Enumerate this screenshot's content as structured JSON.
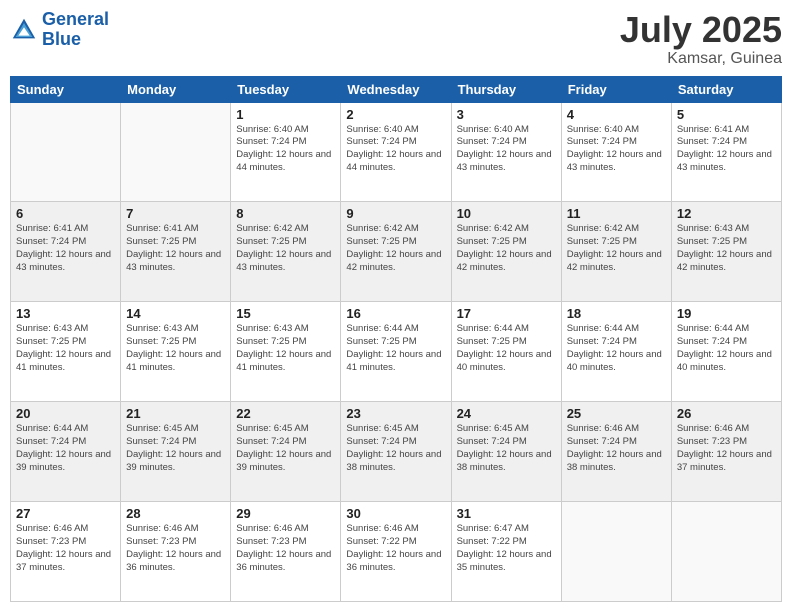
{
  "logo": {
    "line1": "General",
    "line2": "Blue"
  },
  "header": {
    "month": "July 2025",
    "location": "Kamsar, Guinea"
  },
  "weekdays": [
    "Sunday",
    "Monday",
    "Tuesday",
    "Wednesday",
    "Thursday",
    "Friday",
    "Saturday"
  ],
  "weeks": [
    [
      {
        "day": "",
        "sunrise": "",
        "sunset": "",
        "daylight": ""
      },
      {
        "day": "",
        "sunrise": "",
        "sunset": "",
        "daylight": ""
      },
      {
        "day": "1",
        "sunrise": "Sunrise: 6:40 AM",
        "sunset": "Sunset: 7:24 PM",
        "daylight": "Daylight: 12 hours and 44 minutes."
      },
      {
        "day": "2",
        "sunrise": "Sunrise: 6:40 AM",
        "sunset": "Sunset: 7:24 PM",
        "daylight": "Daylight: 12 hours and 44 minutes."
      },
      {
        "day": "3",
        "sunrise": "Sunrise: 6:40 AM",
        "sunset": "Sunset: 7:24 PM",
        "daylight": "Daylight: 12 hours and 43 minutes."
      },
      {
        "day": "4",
        "sunrise": "Sunrise: 6:40 AM",
        "sunset": "Sunset: 7:24 PM",
        "daylight": "Daylight: 12 hours and 43 minutes."
      },
      {
        "day": "5",
        "sunrise": "Sunrise: 6:41 AM",
        "sunset": "Sunset: 7:24 PM",
        "daylight": "Daylight: 12 hours and 43 minutes."
      }
    ],
    [
      {
        "day": "6",
        "sunrise": "Sunrise: 6:41 AM",
        "sunset": "Sunset: 7:24 PM",
        "daylight": "Daylight: 12 hours and 43 minutes."
      },
      {
        "day": "7",
        "sunrise": "Sunrise: 6:41 AM",
        "sunset": "Sunset: 7:25 PM",
        "daylight": "Daylight: 12 hours and 43 minutes."
      },
      {
        "day": "8",
        "sunrise": "Sunrise: 6:42 AM",
        "sunset": "Sunset: 7:25 PM",
        "daylight": "Daylight: 12 hours and 43 minutes."
      },
      {
        "day": "9",
        "sunrise": "Sunrise: 6:42 AM",
        "sunset": "Sunset: 7:25 PM",
        "daylight": "Daylight: 12 hours and 42 minutes."
      },
      {
        "day": "10",
        "sunrise": "Sunrise: 6:42 AM",
        "sunset": "Sunset: 7:25 PM",
        "daylight": "Daylight: 12 hours and 42 minutes."
      },
      {
        "day": "11",
        "sunrise": "Sunrise: 6:42 AM",
        "sunset": "Sunset: 7:25 PM",
        "daylight": "Daylight: 12 hours and 42 minutes."
      },
      {
        "day": "12",
        "sunrise": "Sunrise: 6:43 AM",
        "sunset": "Sunset: 7:25 PM",
        "daylight": "Daylight: 12 hours and 42 minutes."
      }
    ],
    [
      {
        "day": "13",
        "sunrise": "Sunrise: 6:43 AM",
        "sunset": "Sunset: 7:25 PM",
        "daylight": "Daylight: 12 hours and 41 minutes."
      },
      {
        "day": "14",
        "sunrise": "Sunrise: 6:43 AM",
        "sunset": "Sunset: 7:25 PM",
        "daylight": "Daylight: 12 hours and 41 minutes."
      },
      {
        "day": "15",
        "sunrise": "Sunrise: 6:43 AM",
        "sunset": "Sunset: 7:25 PM",
        "daylight": "Daylight: 12 hours and 41 minutes."
      },
      {
        "day": "16",
        "sunrise": "Sunrise: 6:44 AM",
        "sunset": "Sunset: 7:25 PM",
        "daylight": "Daylight: 12 hours and 41 minutes."
      },
      {
        "day": "17",
        "sunrise": "Sunrise: 6:44 AM",
        "sunset": "Sunset: 7:25 PM",
        "daylight": "Daylight: 12 hours and 40 minutes."
      },
      {
        "day": "18",
        "sunrise": "Sunrise: 6:44 AM",
        "sunset": "Sunset: 7:24 PM",
        "daylight": "Daylight: 12 hours and 40 minutes."
      },
      {
        "day": "19",
        "sunrise": "Sunrise: 6:44 AM",
        "sunset": "Sunset: 7:24 PM",
        "daylight": "Daylight: 12 hours and 40 minutes."
      }
    ],
    [
      {
        "day": "20",
        "sunrise": "Sunrise: 6:44 AM",
        "sunset": "Sunset: 7:24 PM",
        "daylight": "Daylight: 12 hours and 39 minutes."
      },
      {
        "day": "21",
        "sunrise": "Sunrise: 6:45 AM",
        "sunset": "Sunset: 7:24 PM",
        "daylight": "Daylight: 12 hours and 39 minutes."
      },
      {
        "day": "22",
        "sunrise": "Sunrise: 6:45 AM",
        "sunset": "Sunset: 7:24 PM",
        "daylight": "Daylight: 12 hours and 39 minutes."
      },
      {
        "day": "23",
        "sunrise": "Sunrise: 6:45 AM",
        "sunset": "Sunset: 7:24 PM",
        "daylight": "Daylight: 12 hours and 38 minutes."
      },
      {
        "day": "24",
        "sunrise": "Sunrise: 6:45 AM",
        "sunset": "Sunset: 7:24 PM",
        "daylight": "Daylight: 12 hours and 38 minutes."
      },
      {
        "day": "25",
        "sunrise": "Sunrise: 6:46 AM",
        "sunset": "Sunset: 7:24 PM",
        "daylight": "Daylight: 12 hours and 38 minutes."
      },
      {
        "day": "26",
        "sunrise": "Sunrise: 6:46 AM",
        "sunset": "Sunset: 7:23 PM",
        "daylight": "Daylight: 12 hours and 37 minutes."
      }
    ],
    [
      {
        "day": "27",
        "sunrise": "Sunrise: 6:46 AM",
        "sunset": "Sunset: 7:23 PM",
        "daylight": "Daylight: 12 hours and 37 minutes."
      },
      {
        "day": "28",
        "sunrise": "Sunrise: 6:46 AM",
        "sunset": "Sunset: 7:23 PM",
        "daylight": "Daylight: 12 hours and 36 minutes."
      },
      {
        "day": "29",
        "sunrise": "Sunrise: 6:46 AM",
        "sunset": "Sunset: 7:23 PM",
        "daylight": "Daylight: 12 hours and 36 minutes."
      },
      {
        "day": "30",
        "sunrise": "Sunrise: 6:46 AM",
        "sunset": "Sunset: 7:22 PM",
        "daylight": "Daylight: 12 hours and 36 minutes."
      },
      {
        "day": "31",
        "sunrise": "Sunrise: 6:47 AM",
        "sunset": "Sunset: 7:22 PM",
        "daylight": "Daylight: 12 hours and 35 minutes."
      },
      {
        "day": "",
        "sunrise": "",
        "sunset": "",
        "daylight": ""
      },
      {
        "day": "",
        "sunrise": "",
        "sunset": "",
        "daylight": ""
      }
    ]
  ]
}
